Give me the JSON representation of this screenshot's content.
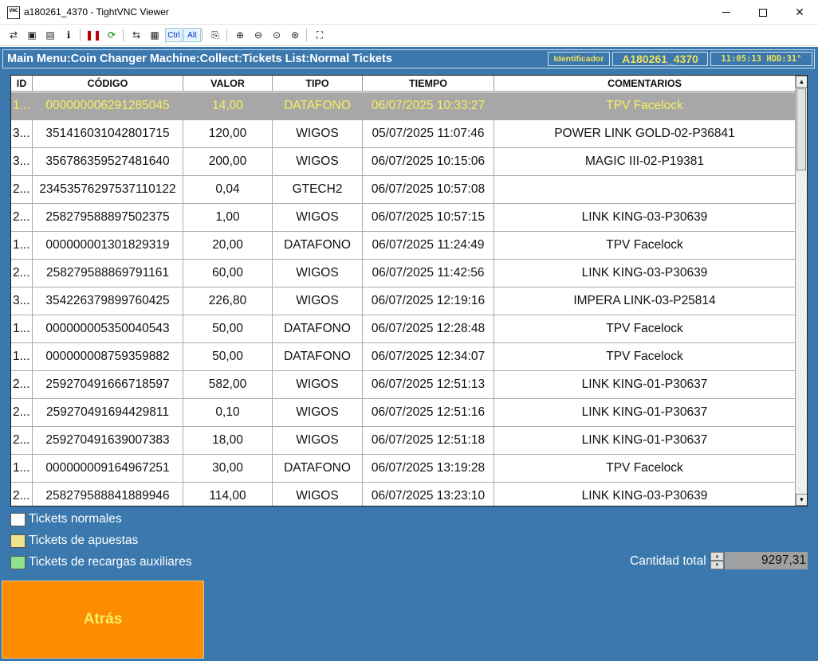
{
  "window": {
    "title": "a180261_4370 - TightVNC Viewer",
    "app_icon_text": "VNC",
    "minimize_glyph": "—",
    "maximize_glyph": "☐",
    "close_glyph": "✕"
  },
  "toolbar": {
    "items": [
      {
        "name": "new-connection-icon",
        "glyph": "⇄"
      },
      {
        "name": "save-icon",
        "glyph": "▣"
      },
      {
        "name": "options-icon",
        "glyph": "▤"
      },
      {
        "name": "connection-info-icon",
        "glyph": "ℹ"
      },
      {
        "name": "pause-icon",
        "glyph": "❚❚"
      },
      {
        "name": "refresh-icon",
        "glyph": "⟳"
      },
      {
        "name": "transfer-icon",
        "glyph": "⇆"
      },
      {
        "name": "file-transfer-icon",
        "glyph": "▦"
      },
      {
        "name": "ctrl-key",
        "glyph": "Ctrl"
      },
      {
        "name": "alt-key",
        "glyph": "Alt"
      },
      {
        "name": "clipboard-icon",
        "glyph": "⎘"
      },
      {
        "name": "zoom-in-icon",
        "glyph": "⊕"
      },
      {
        "name": "zoom-out-icon",
        "glyph": "⊖"
      },
      {
        "name": "zoom-100-icon",
        "glyph": "⊙"
      },
      {
        "name": "zoom-auto-icon",
        "glyph": "⊛"
      },
      {
        "name": "fullscreen-icon",
        "glyph": "⛶"
      }
    ]
  },
  "header": {
    "breadcrumb": "Main Menu:Coin Changer Machine:Collect:Tickets List:Normal Tickets",
    "id_label": "Identificador",
    "id_value": "A180261_4370",
    "clock": "11:05:13 HDD:31°"
  },
  "table": {
    "columns": [
      "ID",
      "CÓDIGO",
      "VALOR",
      "TIPO",
      "TIEMPO",
      "COMENTARIOS"
    ],
    "rows": [
      {
        "id": "1...",
        "codigo": "000000006291285045",
        "valor": "14,00",
        "tipo": "DATAFONO",
        "tiempo": "06/07/2025 10:33:27",
        "comentarios": "TPV Facelock",
        "selected": true
      },
      {
        "id": "3...",
        "codigo": "351416031042801715",
        "valor": "120,00",
        "tipo": "WIGOS",
        "tiempo": "05/07/2025 11:07:46",
        "comentarios": "POWER LINK GOLD-02-P36841",
        "selected": false
      },
      {
        "id": "3...",
        "codigo": "356786359527481640",
        "valor": "200,00",
        "tipo": "WIGOS",
        "tiempo": "06/07/2025 10:15:06",
        "comentarios": "MAGIC III-02-P19381",
        "selected": false
      },
      {
        "id": "2...",
        "codigo": "234535762975371101​22",
        "valor": "0,04",
        "tipo": "GTECH2",
        "tiempo": "06/07/2025 10:57:08",
        "comentarios": "",
        "selected": false
      },
      {
        "id": "2...",
        "codigo": "258279588897502375",
        "valor": "1,00",
        "tipo": "WIGOS",
        "tiempo": "06/07/2025 10:57:15",
        "comentarios": "LINK KING-03-P30639",
        "selected": false
      },
      {
        "id": "1...",
        "codigo": "000000001301829319",
        "valor": "20,00",
        "tipo": "DATAFONO",
        "tiempo": "06/07/2025 11:24:49",
        "comentarios": "TPV Facelock",
        "selected": false
      },
      {
        "id": "2...",
        "codigo": "258279588869791161",
        "valor": "60,00",
        "tipo": "WIGOS",
        "tiempo": "06/07/2025 11:42:56",
        "comentarios": "LINK KING-03-P30639",
        "selected": false
      },
      {
        "id": "3...",
        "codigo": "354226379899760425",
        "valor": "226,80",
        "tipo": "WIGOS",
        "tiempo": "06/07/2025 12:19:16",
        "comentarios": "IMPERA LINK-03-P25814",
        "selected": false
      },
      {
        "id": "1...",
        "codigo": "000000005350040543",
        "valor": "50,00",
        "tipo": "DATAFONO",
        "tiempo": "06/07/2025 12:28:48",
        "comentarios": "TPV Facelock",
        "selected": false
      },
      {
        "id": "1...",
        "codigo": "000000008759359882",
        "valor": "50,00",
        "tipo": "DATAFONO",
        "tiempo": "06/07/2025 12:34:07",
        "comentarios": "TPV Facelock",
        "selected": false
      },
      {
        "id": "2...",
        "codigo": "259270491666718597",
        "valor": "582,00",
        "tipo": "WIGOS",
        "tiempo": "06/07/2025 12:51:13",
        "comentarios": "LINK KING-01-P30637",
        "selected": false
      },
      {
        "id": "2...",
        "codigo": "259270491694429811",
        "valor": "0,10",
        "tipo": "WIGOS",
        "tiempo": "06/07/2025 12:51:16",
        "comentarios": "LINK KING-01-P30637",
        "selected": false
      },
      {
        "id": "2...",
        "codigo": "259270491639007383",
        "valor": "18,00",
        "tipo": "WIGOS",
        "tiempo": "06/07/2025 12:51:18",
        "comentarios": "LINK KING-01-P30637",
        "selected": false
      },
      {
        "id": "1...",
        "codigo": "000000009164967251",
        "valor": "30,00",
        "tipo": "DATAFONO",
        "tiempo": "06/07/2025 13:19:28",
        "comentarios": "TPV Facelock",
        "selected": false
      },
      {
        "id": "2...",
        "codigo": "258279588841889946",
        "valor": "114,00",
        "tipo": "WIGOS",
        "tiempo": "06/07/2025 13:23:10",
        "comentarios": "LINK KING-03-P30639",
        "selected": false
      }
    ],
    "scroll_up_glyph": "▲",
    "scroll_down_glyph": "▼"
  },
  "legend": [
    {
      "label": "Tickets normales",
      "color": "#ffffff"
    },
    {
      "label": "Tickets de apuestas",
      "color": "#eee28e"
    },
    {
      "label": "Tickets de recargas auxiliares",
      "color": "#8fe08f"
    }
  ],
  "total": {
    "label": "Cantidad total",
    "value": "9297,31",
    "spin_up": "▲",
    "spin_down": "▼"
  },
  "back_button": {
    "label": "Atrás"
  },
  "colors": {
    "background": "#3a78ad",
    "selected_row": "#a7a7a7",
    "selected_text": "#f7f15a",
    "back_button": "#fd8c00",
    "accent_text": "#f1e05a"
  }
}
